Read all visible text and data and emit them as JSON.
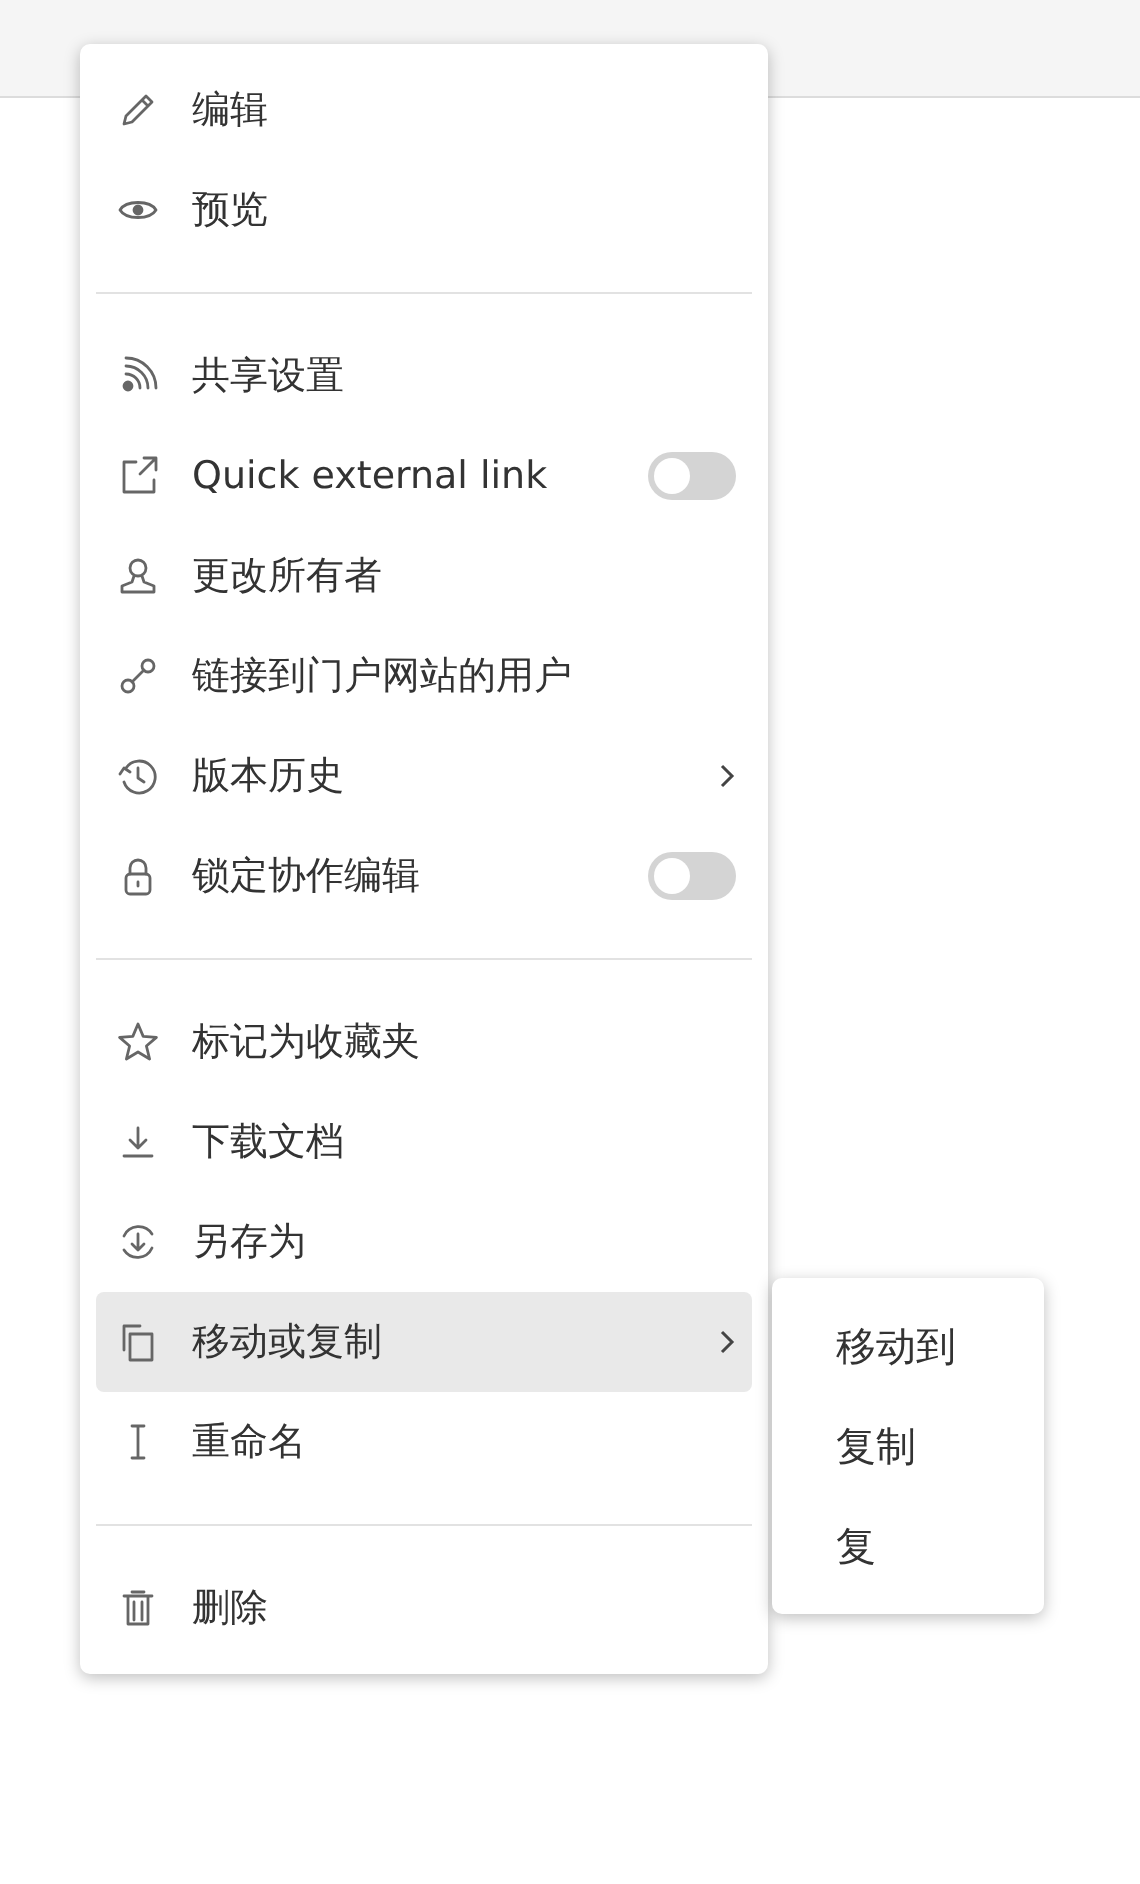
{
  "menu": {
    "sections": [
      {
        "items": [
          {
            "label": "编辑",
            "kind": "plain",
            "selected": false
          },
          {
            "label": "预览",
            "kind": "plain",
            "selected": false
          }
        ]
      },
      {
        "items": [
          {
            "label": "共享设置",
            "kind": "plain",
            "selected": false
          },
          {
            "label": "Quick external link",
            "kind": "toggle",
            "on": false,
            "selected": false
          },
          {
            "label": "更改所有者",
            "kind": "plain",
            "selected": false
          },
          {
            "label": "链接到门户网站的用户",
            "kind": "plain",
            "selected": false
          },
          {
            "label": "版本历史",
            "kind": "submenu",
            "selected": false
          },
          {
            "label": "锁定协作编辑",
            "kind": "toggle",
            "on": false,
            "selected": false
          }
        ]
      },
      {
        "items": [
          {
            "label": "标记为收藏夹",
            "kind": "plain",
            "selected": false
          },
          {
            "label": "下载文档",
            "kind": "plain",
            "selected": false
          },
          {
            "label": "另存为",
            "kind": "plain",
            "selected": false
          },
          {
            "label": "移动或复制",
            "kind": "submenu",
            "selected": true
          },
          {
            "label": "重命名",
            "kind": "plain",
            "selected": false
          }
        ]
      },
      {
        "items": [
          {
            "label": "删除",
            "kind": "plain",
            "selected": false
          }
        ]
      }
    ]
  },
  "submenu": {
    "items": [
      "移动到",
      "复制",
      "复"
    ]
  }
}
